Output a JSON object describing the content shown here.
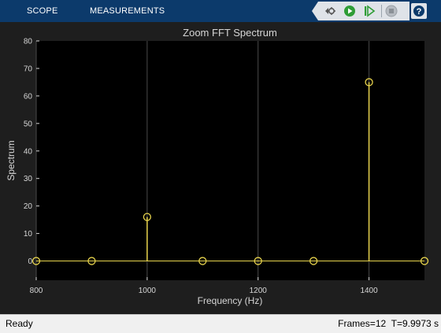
{
  "toolstrip": {
    "tabs": [
      {
        "label": "SCOPE"
      },
      {
        "label": "MEASUREMENTS"
      }
    ],
    "help_label": "?",
    "controls": [
      "zoom-config-icon",
      "run-icon",
      "step-forward-icon",
      "stop-icon"
    ]
  },
  "status": {
    "left": "Ready",
    "frames": "Frames=12",
    "time": "T=9.9973 s"
  },
  "colors": {
    "stem": "#e8d44d",
    "axes_bg": "#000000",
    "figure_bg": "#1e1e1e",
    "grid": "#4a4a4a",
    "toolstrip": "#0c3a6b"
  },
  "chart_data": {
    "type": "stem",
    "title": "Zoom FFT Spectrum",
    "xlabel": "Frequency (Hz)",
    "ylabel": "Spectrum",
    "xlim": [
      800,
      1500
    ],
    "ylim": [
      -7,
      80
    ],
    "xticks": [
      800,
      1000,
      1200,
      1400
    ],
    "yticks": [
      0,
      10,
      20,
      30,
      40,
      50,
      60,
      70,
      80
    ],
    "grid": true,
    "x": [
      800,
      900,
      1000,
      1100,
      1200,
      1300,
      1400,
      1500
    ],
    "y": [
      0,
      0,
      16,
      0,
      0,
      0,
      65,
      0
    ]
  }
}
